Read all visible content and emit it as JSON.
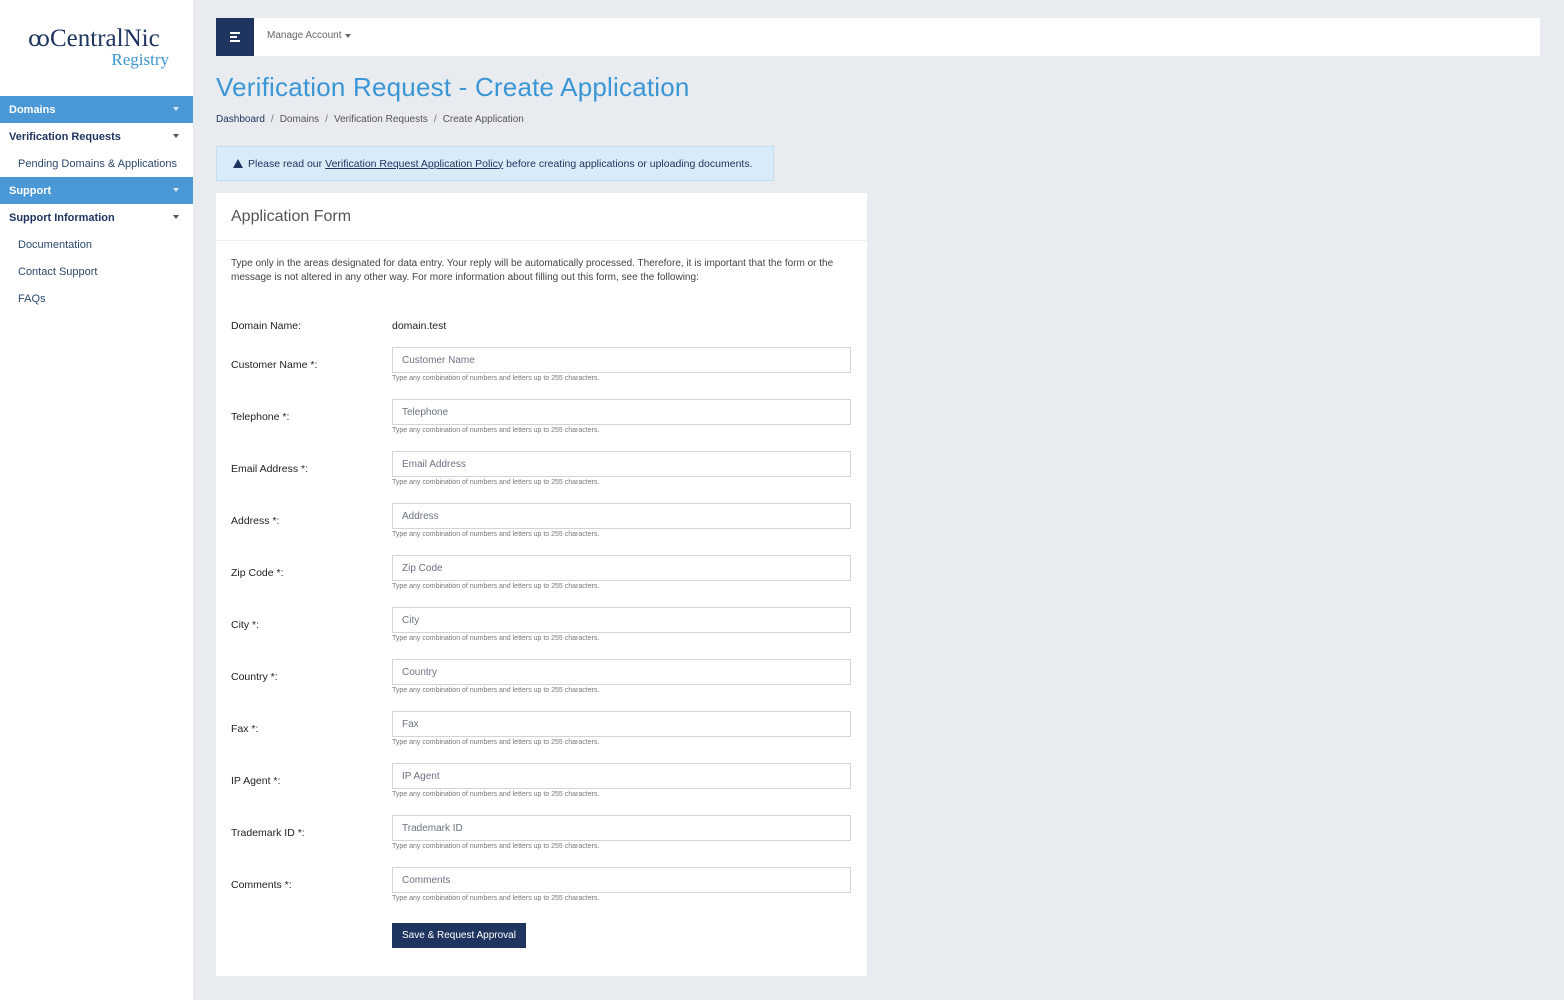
{
  "logo": {
    "brand": "CentralNic",
    "sub": "Registry",
    "mark": "ꝏ"
  },
  "sidebar": {
    "items": [
      {
        "label": "Domains",
        "type": "section"
      },
      {
        "label": "Verification Requests",
        "type": "group"
      },
      {
        "label": "Pending Domains & Applications",
        "type": "link"
      },
      {
        "label": "Support",
        "type": "section"
      },
      {
        "label": "Support Information",
        "type": "group"
      },
      {
        "label": "Documentation",
        "type": "link"
      },
      {
        "label": "Contact Support",
        "type": "link"
      },
      {
        "label": "FAQs",
        "type": "link"
      }
    ]
  },
  "topbar": {
    "manage_label": "Manage Account"
  },
  "page": {
    "title": "Verification Request - Create Application",
    "breadcrumb": [
      "Dashboard",
      "Domains",
      "Verification Requests",
      "Create Application"
    ]
  },
  "alert": {
    "prefix": "Please read our",
    "link": "Verification Request Application Policy",
    "suffix": "before creating applications or uploading documents."
  },
  "form": {
    "title": "Application Form",
    "intro": "Type only in the areas designated for data entry. Your reply will be automatically processed. Therefore, it is important that the form or the message is not altered in any other way. For more information about filling out this form, see the following:",
    "domain_label": "Domain Name:",
    "domain_value": "domain.test",
    "help": "Type any combination of numbers and letters up to 255 characters.",
    "fields": [
      {
        "label": "Customer Name *:",
        "placeholder": "Customer Name"
      },
      {
        "label": "Telephone *:",
        "placeholder": "Telephone"
      },
      {
        "label": "Email Address *:",
        "placeholder": "Email Address"
      },
      {
        "label": "Address *:",
        "placeholder": "Address"
      },
      {
        "label": "Zip Code *:",
        "placeholder": "Zip Code"
      },
      {
        "label": "City *:",
        "placeholder": "City"
      },
      {
        "label": "Country *:",
        "placeholder": "Country"
      },
      {
        "label": "Fax *:",
        "placeholder": "Fax"
      },
      {
        "label": "IP Agent *:",
        "placeholder": "IP Agent"
      },
      {
        "label": "Trademark ID *:",
        "placeholder": "Trademark ID"
      },
      {
        "label": "Comments *:",
        "placeholder": "Comments"
      }
    ],
    "submit_label": "Save & Request Approval"
  },
  "colors": {
    "brand_navy": "#1f3560",
    "accent_blue": "#4a98d6",
    "title_blue": "#3a96d4"
  }
}
